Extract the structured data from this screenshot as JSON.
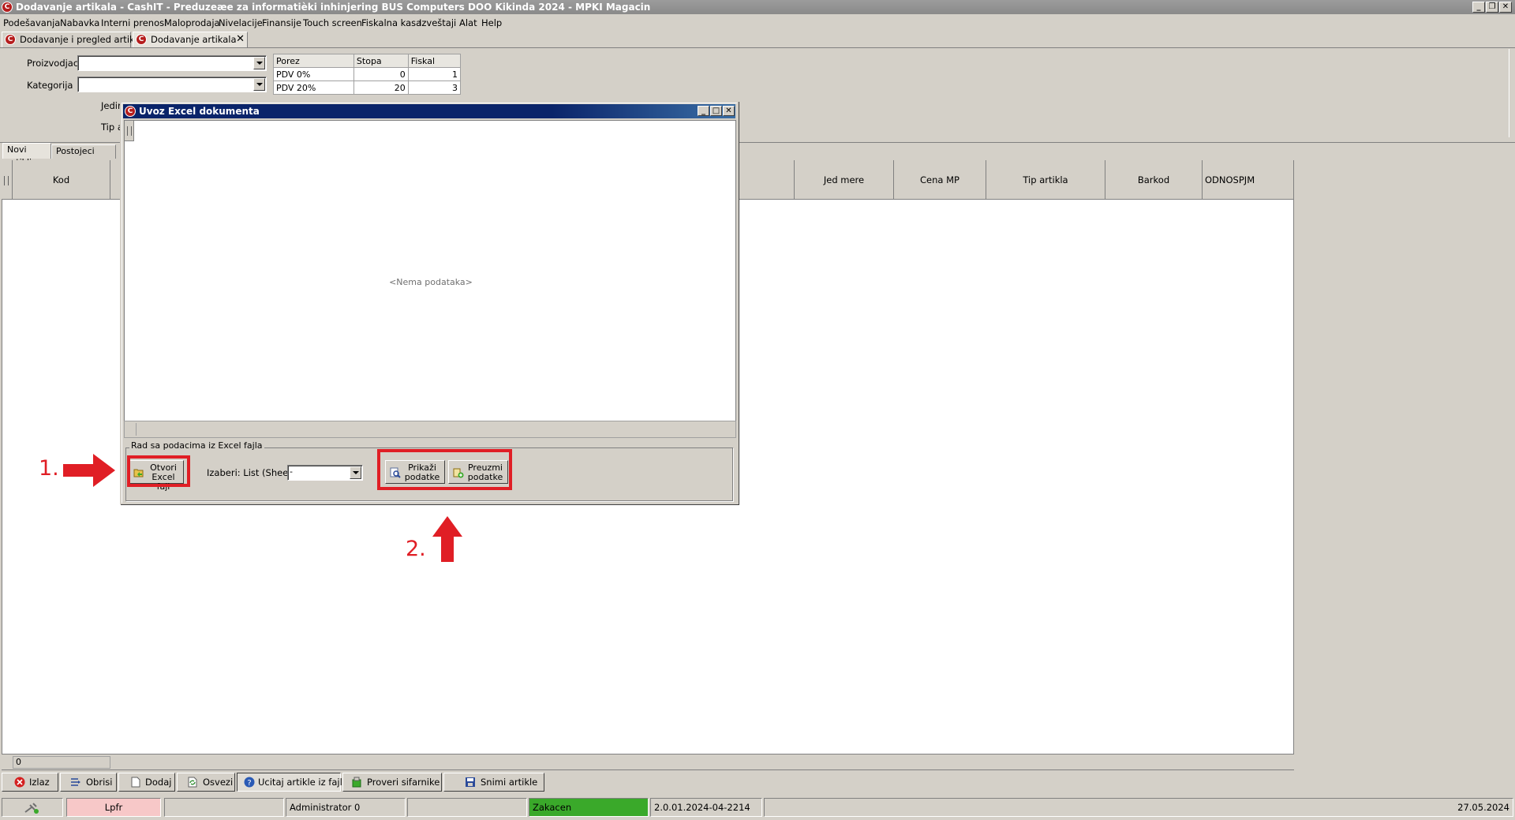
{
  "window": {
    "title": "Dodavanje artikala - CashIT - Preduzeæe za informatièki inhinjering BUS Computers DOO Kikinda 2024 - MPKI Magacin",
    "logo_letter": "C"
  },
  "menu": [
    "Podešavanja",
    "Nabavka",
    "Interni prenosi",
    "Maloprodaja",
    "Nivelacije",
    "Finansije",
    "Touch screen",
    "Fiskalna kasa",
    "Izveštaji",
    "Alat",
    "Help"
  ],
  "tabs": [
    {
      "label": "Dodavanje i pregled artikala"
    },
    {
      "label": "Dodavanje artikala",
      "close": "✕"
    }
  ],
  "form": {
    "labels": [
      "Proizvodjac",
      "Kategorija",
      "Jedir",
      "Tip a"
    ]
  },
  "tax_table": {
    "headers": [
      "Porez",
      "Stopa",
      "Fiskal"
    ],
    "rows": [
      [
        "PDV 0%",
        "0",
        "1"
      ],
      [
        "PDV 20%",
        "20",
        "3"
      ]
    ]
  },
  "subtabs": [
    "Novi artikli",
    "Postojeci artikli"
  ],
  "grid": {
    "columns": [
      "Kod",
      "Jed mere",
      "Cena MP",
      "Tip artikla",
      "Barkod",
      "ODNOSPJM"
    ],
    "footer_count": "0"
  },
  "dialog": {
    "title": "Uvoz Excel dokumenta",
    "empty_text": "<Nema podataka>",
    "group_label": "Rad sa podacima iz Excel fajla",
    "open_button": [
      "Otvori",
      "Excel fajl"
    ],
    "sheet_label": "Izaberi: List (Sheet)",
    "sheet_value": "-",
    "show_button": [
      "Prikaži",
      "podatke"
    ],
    "fetch_button": [
      "Preuzmi",
      "podatke"
    ]
  },
  "annotations": {
    "step1": "1.",
    "step2": "2."
  },
  "toolbar": [
    "Izlaz",
    "Obrisi",
    "Dodaj",
    "Osvezi",
    "Ucitaj artikle iz fajla",
    "Proveri sifarnike",
    "Snimi artikle"
  ],
  "status": {
    "user_panel": "Lpfr",
    "admin": "Administrator 0",
    "state": "Zakacen",
    "version": "2.0.01.2024-04-2214",
    "date": "27.05.2024"
  },
  "colors": {
    "accent_red": "#e01e25",
    "dialog_title": "#0a246a",
    "status_green": "#3aa92a",
    "status_pink": "#f7c8c8"
  }
}
